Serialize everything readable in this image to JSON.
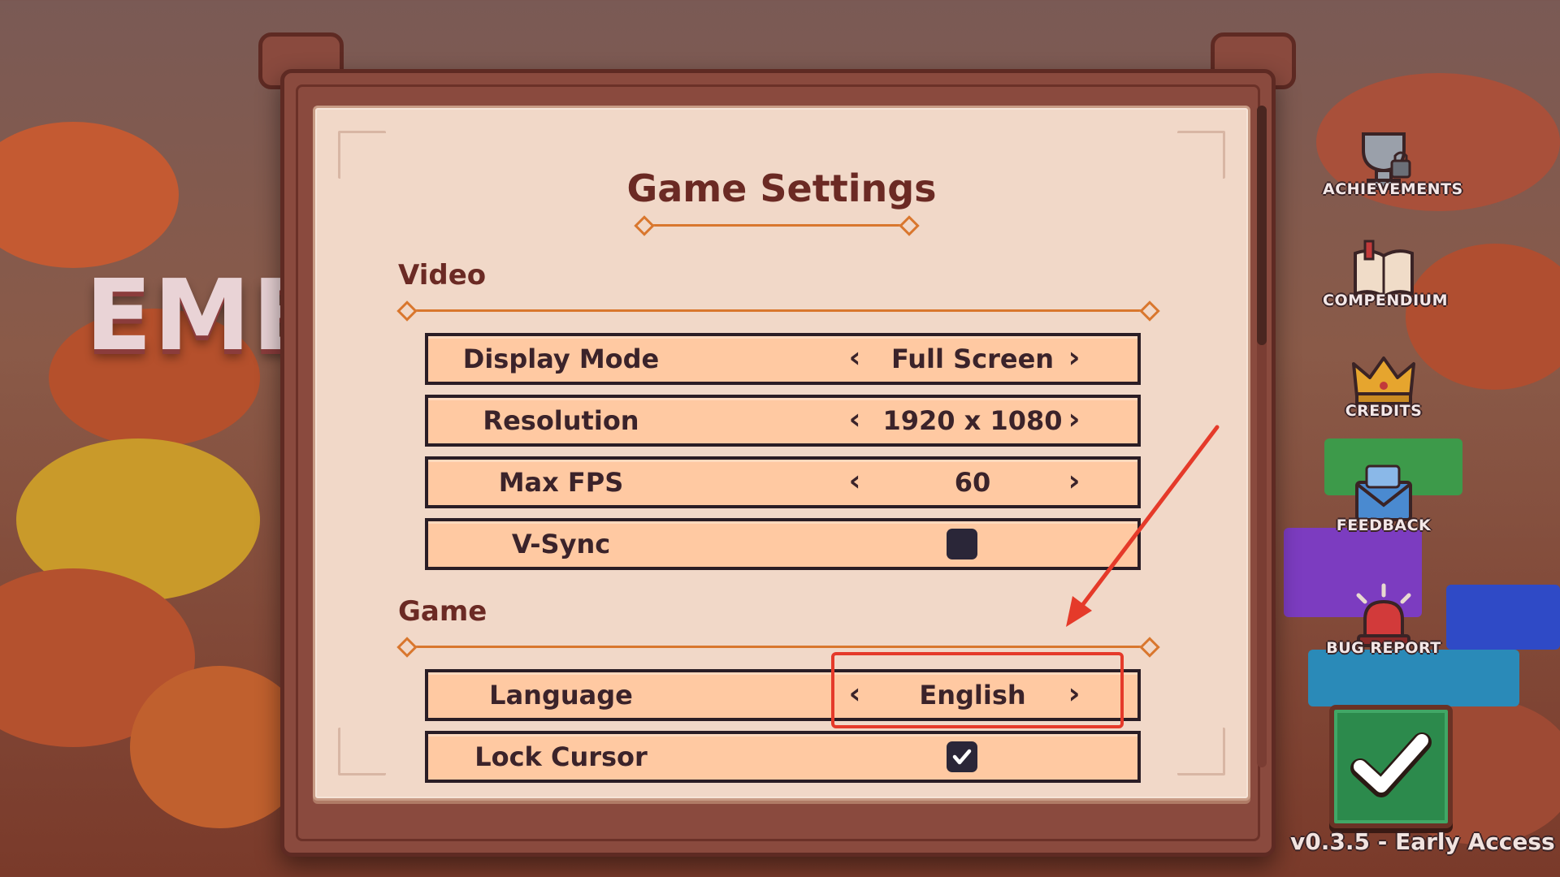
{
  "background": {
    "logo_text": "EMB"
  },
  "settings": {
    "title": "Game Settings",
    "sections": {
      "video": {
        "title": "Video",
        "display_mode": {
          "label": "Display Mode",
          "value": "Full Screen"
        },
        "resolution": {
          "label": "Resolution",
          "value": "1920 x 1080"
        },
        "max_fps": {
          "label": "Max FPS",
          "value": "60"
        },
        "vsync": {
          "label": "V-Sync",
          "checked": false
        }
      },
      "game": {
        "title": "Game",
        "language": {
          "label": "Language",
          "value": "English"
        },
        "lock_cursor": {
          "label": "Lock Cursor",
          "checked": true
        }
      }
    },
    "arrow_left_glyph": "‹",
    "arrow_right_glyph": "›"
  },
  "side_menu": {
    "items": [
      {
        "label": "ACHIEVEMENTS",
        "icon": "trophy-locked-icon"
      },
      {
        "label": "COMPENDIUM",
        "icon": "book-icon"
      },
      {
        "label": "CREDITS",
        "icon": "crown-icon"
      },
      {
        "label": "FEEDBACK",
        "icon": "envelope-icon"
      },
      {
        "label": "BUG REPORT",
        "icon": "alarm-icon"
      }
    ]
  },
  "confirm": {
    "icon": "checkmark-icon"
  },
  "version": "v0.3.5 - Early Access",
  "colors": {
    "highlight": "#e53a2a",
    "accent": "#d9772e",
    "row_bg": "#ffc9a2",
    "confirm_green": "#2c8a4c"
  }
}
